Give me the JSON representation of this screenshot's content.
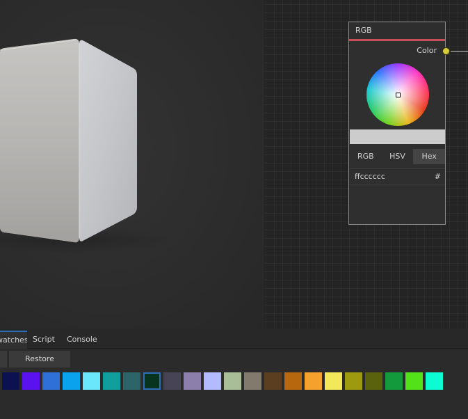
{
  "node": {
    "title": "RGB",
    "output_label": "Color",
    "preview_color": "#cccccc",
    "accent_color": "#c8505a",
    "modes": [
      "RGB",
      "HSV",
      "Hex"
    ],
    "active_mode": "Hex",
    "hex_value": "ffcccccc",
    "hex_suffix": "#"
  },
  "bottom_panel": {
    "tabs": [
      "Swatches",
      "Script",
      "Console"
    ],
    "active_tab": "Swatches",
    "restore_label": "Restore",
    "swatches": [
      "#0c1150",
      "#5a12ee",
      "#2f6fd8",
      "#0aa2ec",
      "#6ae7fb",
      "#119f9e",
      "#2d6468",
      "#08341f",
      "#474555",
      "#8c7fac",
      "#b3bafe",
      "#a9bd99",
      "#827a6d",
      "#5a3e1f",
      "#b7680f",
      "#f4a12d",
      "#f3e85a",
      "#9e9a10",
      "#5a620d",
      "#139a3c",
      "#53e21a",
      "#0dfbd2"
    ],
    "selected_swatch": 7
  }
}
